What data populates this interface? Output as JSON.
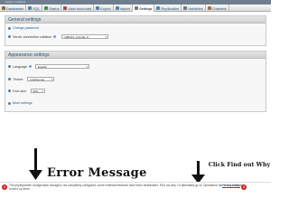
{
  "header": {
    "breadcrumb": "Server: localhost"
  },
  "tabs": [
    {
      "label": "Databases",
      "color": "#8a6d3b"
    },
    {
      "label": "SQL",
      "color": "#5b7fa6"
    },
    {
      "label": "Status",
      "color": "#4a8a4a"
    },
    {
      "label": "User accounts",
      "color": "#a05050"
    },
    {
      "label": "Export",
      "color": "#5b7fa6"
    },
    {
      "label": "Import",
      "color": "#5b7fa6"
    },
    {
      "label": "Settings",
      "color": "#777777"
    },
    {
      "label": "Replication",
      "color": "#5b7fa6"
    },
    {
      "label": "Variables",
      "color": "#777777"
    },
    {
      "label": "Charsets",
      "color": "#a07040"
    }
  ],
  "general": {
    "title": "General settings",
    "change_password": "Change password",
    "collation_label": "Server connection collation",
    "collation_value": "utf8mb4_unicode_ci"
  },
  "appearance": {
    "title": "Appearance settings",
    "language_label": "Language",
    "language_value": "English",
    "theme_label": "Theme:",
    "theme_value": "pmahomme",
    "font_label": "Font size:",
    "font_value": "82%",
    "more_settings": "More settings"
  },
  "footer": {
    "message": "The phpMyAdmin configuration storage is not completely configured, some extended features have been deactivated. Find out why. Or alternately go to 'Operations' tab of any database to set it up there.",
    "link": "Find out why."
  },
  "annotations": {
    "error_title": "Error Message",
    "click_text": "Click Find out Why",
    "badge_1": "1",
    "badge_2": "2"
  },
  "colors": {
    "accent": "#235a81",
    "badge": "#cc1f1f"
  }
}
